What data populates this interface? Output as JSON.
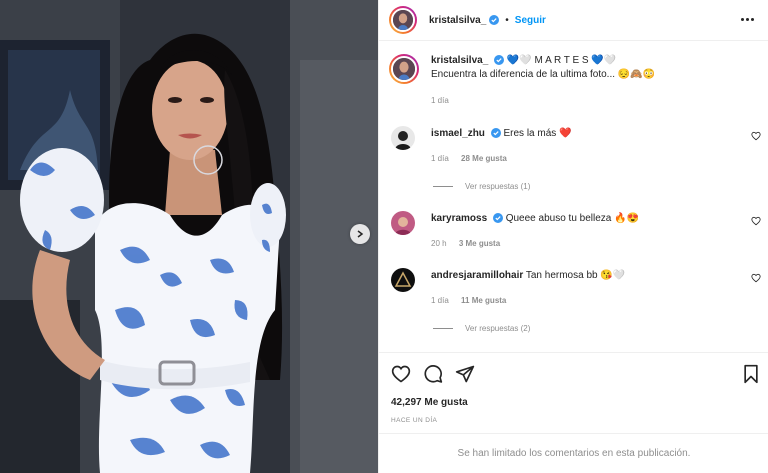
{
  "post": {
    "username": "kristalsilva_",
    "separator": "•",
    "follow_label": "Seguir",
    "more_icon": "more-options-icon"
  },
  "caption": {
    "username": "kristalsilva_",
    "title": "💙🤍 M A R T E S 💙🤍",
    "text": "Encuentra la diferencia de la ultima foto... 😔🙈😳",
    "time": "1 día"
  },
  "comments": [
    {
      "username": "ismael_zhu",
      "verified": true,
      "text": "Eres la más ❤️",
      "time": "1 día",
      "likes": "28 Me gusta",
      "replies": "Ver respuestas (1)"
    },
    {
      "username": "karyramoss",
      "verified": true,
      "text": "Queee abuso tu belleza 🔥😍",
      "time": "20 h",
      "likes": "3 Me gusta",
      "replies": ""
    },
    {
      "username": "andresjaramillohair",
      "verified": false,
      "text": "Tan hermosa bb 😘🤍",
      "time": "1 día",
      "likes": "11 Me gusta",
      "replies": "Ver respuestas (2)"
    }
  ],
  "engagement": {
    "likes_total": "42,297 Me gusta",
    "posted_ago": "HACE UN DÍA"
  },
  "footer": {
    "comments_limited": "Se han limitado los comentarios en esta publicación."
  },
  "colors": {
    "link_blue": "#0095f6",
    "verified_blue": "#3897f0",
    "secondary_text": "#8e8e8e",
    "heart_red": "#ed4956"
  }
}
